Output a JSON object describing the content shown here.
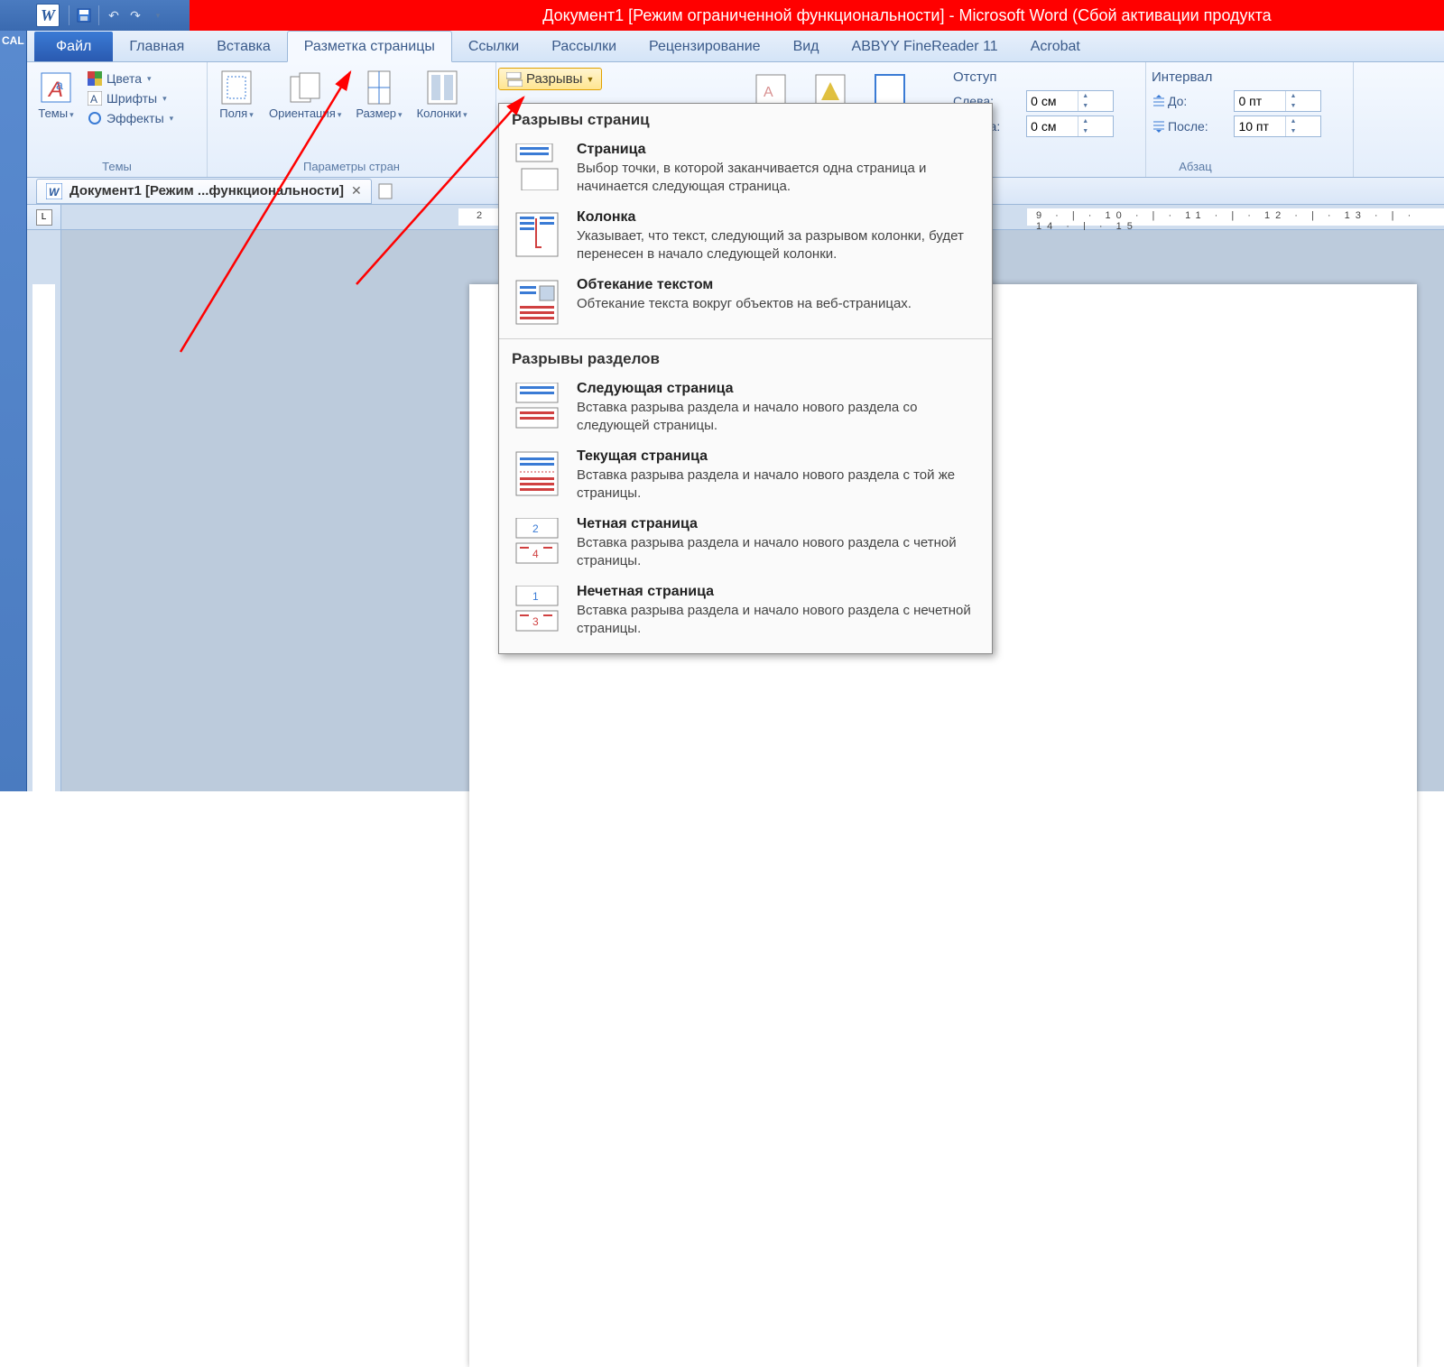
{
  "titlebar": {
    "title": "Документ1 [Режим ограниченной функциональности]  -  Microsoft Word (Сбой активации продукта",
    "left_stub": "CAL"
  },
  "tabs": {
    "file": "Файл",
    "home": "Главная",
    "insert": "Вставка",
    "page_layout": "Разметка страницы",
    "references": "Ссылки",
    "mailings": "Рассылки",
    "review": "Рецензирование",
    "view": "Вид",
    "abbyy": "ABBYY FineReader 11",
    "acrobat": "Acrobat"
  },
  "ribbon": {
    "themes": {
      "label": "Темы",
      "button": "Темы",
      "colors": "Цвета",
      "fonts": "Шрифты",
      "effects": "Эффекты"
    },
    "page_setup": {
      "label": "Параметры стран",
      "margins": "Поля",
      "orientation": "Ориентация",
      "size": "Размер",
      "columns": "Колонки",
      "breaks": "Разрывы"
    },
    "indent": {
      "header": "Отступ",
      "left_label": "Слева:",
      "left_value": "0 см",
      "right_label": "Справа:",
      "right_value": "0 см"
    },
    "spacing": {
      "header": "Интервал",
      "before_label": "До:",
      "before_value": "0 пт",
      "after_label": "После:",
      "after_value": "10 пт"
    },
    "paragraph_label": "Абзац"
  },
  "doc_tab": {
    "title": "Документ1 [Режим ...функциональности]"
  },
  "dropdown": {
    "section1": "Разрывы страниц",
    "items1": [
      {
        "title": "Страница",
        "desc": "Выбор точки, в которой заканчивается одна страница и начинается следующая страница."
      },
      {
        "title": "Колонка",
        "desc": "Указывает, что текст, следующий за разрывом колонки, будет перенесен в начало следующей колонки."
      },
      {
        "title": "Обтекание текстом",
        "desc": "Обтекание текста вокруг объектов на веб-страницах."
      }
    ],
    "section2": "Разрывы разделов",
    "items2": [
      {
        "title": "Следующая страница",
        "desc": "Вставка разрыва раздела и начало нового раздела со следующей страницы."
      },
      {
        "title": "Текущая страница",
        "desc": "Вставка разрыва раздела и начало нового раздела с той же страницы."
      },
      {
        "title": "Четная страница",
        "desc": "Вставка разрыва раздела и начало нового раздела с четной страницы."
      },
      {
        "title": "Нечетная страница",
        "desc": "Вставка разрыва раздела и начало нового раздела с нечетной страницы."
      }
    ]
  },
  "ruler": {
    "marks_left": "2",
    "marks_right": "9 · | · 10 · | · 11 · | · 12 · | · 13 · | · 14 · | · 15"
  }
}
